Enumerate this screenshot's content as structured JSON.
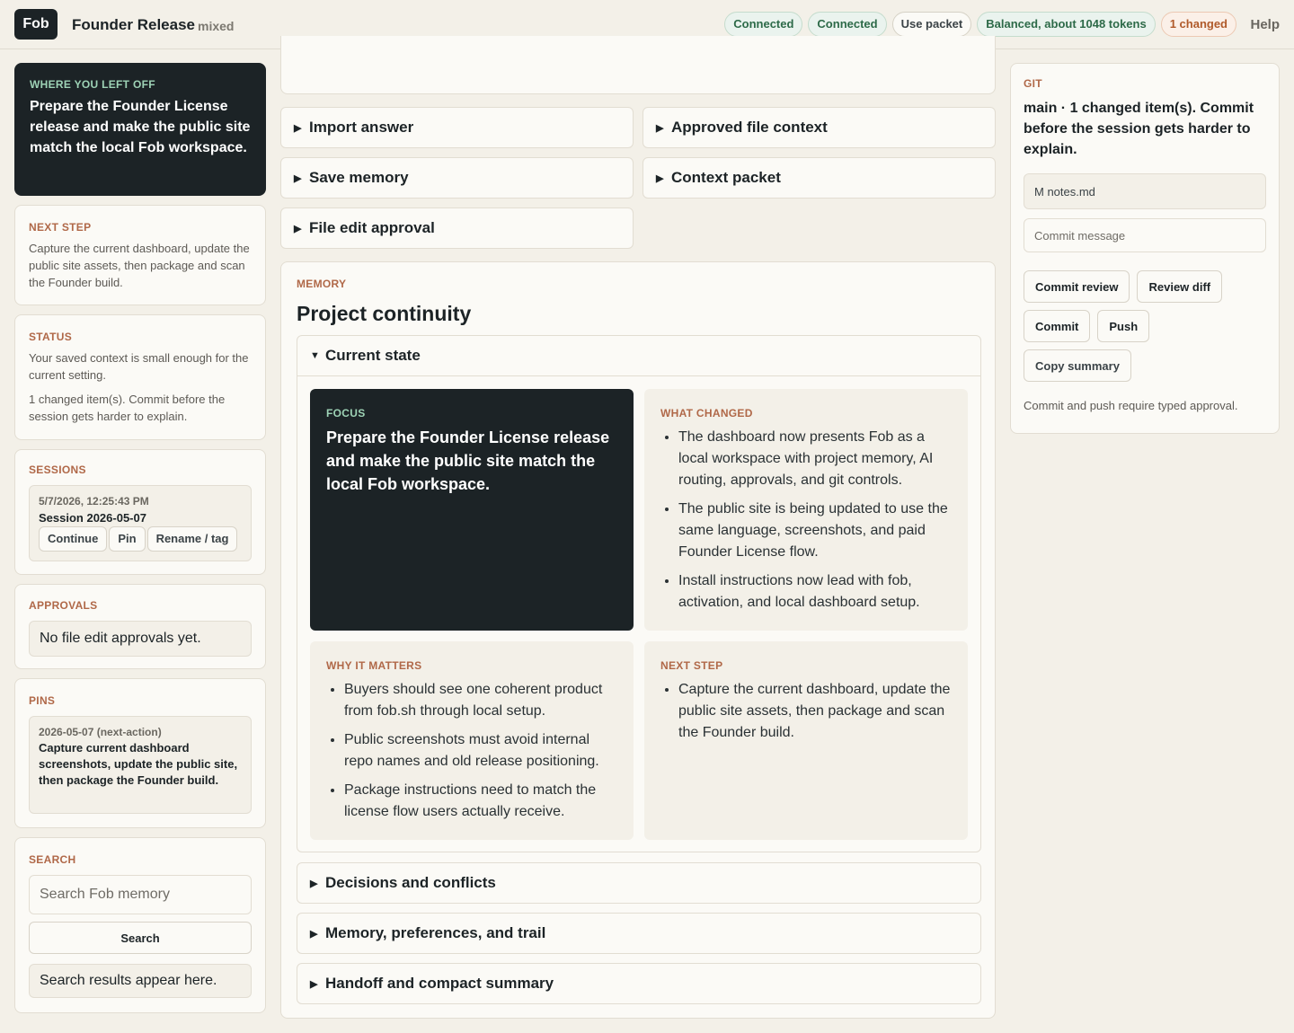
{
  "header": {
    "logo": "Fob",
    "title": "Founder Release",
    "mode": "mixed",
    "pills": [
      "Connected",
      "Connected",
      "Use packet",
      "Balanced, about 1048 tokens",
      "1 changed"
    ],
    "help": "Help"
  },
  "left": {
    "where": {
      "label": "WHERE YOU LEFT OFF",
      "text": "Prepare the Founder License release and make the public site match the local Fob workspace."
    },
    "next": {
      "label": "NEXT STEP",
      "text": "Capture the current dashboard, update the public site assets, then package and scan the Founder build."
    },
    "status": {
      "label": "STATUS",
      "line1": "Your saved context is small enough for the current setting.",
      "line2": "1 changed item(s). Commit before the session gets harder to explain."
    },
    "sessions": {
      "label": "SESSIONS",
      "date": "5/7/2026, 12:25:43 PM",
      "name": "Session 2026-05-07",
      "continue": "Continue",
      "pin": "Pin",
      "rename": "Rename / tag"
    },
    "approvals": {
      "label": "APPROVALS",
      "empty": "No file edit approvals yet."
    },
    "pins": {
      "label": "PINS",
      "meta": "2026-05-07 (next-action)",
      "text": "Capture current dashboard screenshots, update the public site, then package the Founder build."
    },
    "search": {
      "label": "SEARCH",
      "placeholder": "Search Fob memory",
      "button": "Search",
      "results": "Search results appear here."
    }
  },
  "center": {
    "top_acc": {
      "import": "Import answer",
      "approved": "Approved file context",
      "save": "Save memory",
      "packet": "Context packet",
      "file_edit": "File edit approval"
    },
    "memory": {
      "label": "MEMORY",
      "title": "Project continuity",
      "current": "Current state",
      "focus": {
        "label": "FOCUS",
        "text": "Prepare the Founder License release and make the public site match the local Fob workspace."
      },
      "changed": {
        "label": "WHAT CHANGED",
        "items": [
          "The dashboard now presents Fob as a local workspace with project memory, AI routing, approvals, and git controls.",
          "The public site is being updated to use the same language, screenshots, and paid Founder License flow.",
          "Install instructions now lead with fob, activation, and local dashboard setup."
        ]
      },
      "why": {
        "label": "WHY IT MATTERS",
        "items": [
          "Buyers should see one coherent product from fob.sh through local setup.",
          "Public screenshots must avoid internal repo names and old release positioning.",
          "Package instructions need to match the license flow users actually receive."
        ]
      },
      "next": {
        "label": "NEXT STEP",
        "items": [
          "Capture the current dashboard, update the public site assets, then package and scan the Founder build."
        ]
      },
      "decisions": "Decisions and conflicts",
      "prefs": "Memory, preferences, and trail",
      "handoff": "Handoff and compact summary"
    }
  },
  "git": {
    "label": "GIT",
    "summary": "main · 1 changed item(s). Commit before the session gets harder to explain.",
    "file": "M notes.md",
    "commit_placeholder": "Commit message",
    "commit_review": "Commit review",
    "review_diff": "Review diff",
    "commit": "Commit",
    "push": "Push",
    "copy_summary": "Copy summary",
    "note": "Commit and push require typed approval."
  }
}
